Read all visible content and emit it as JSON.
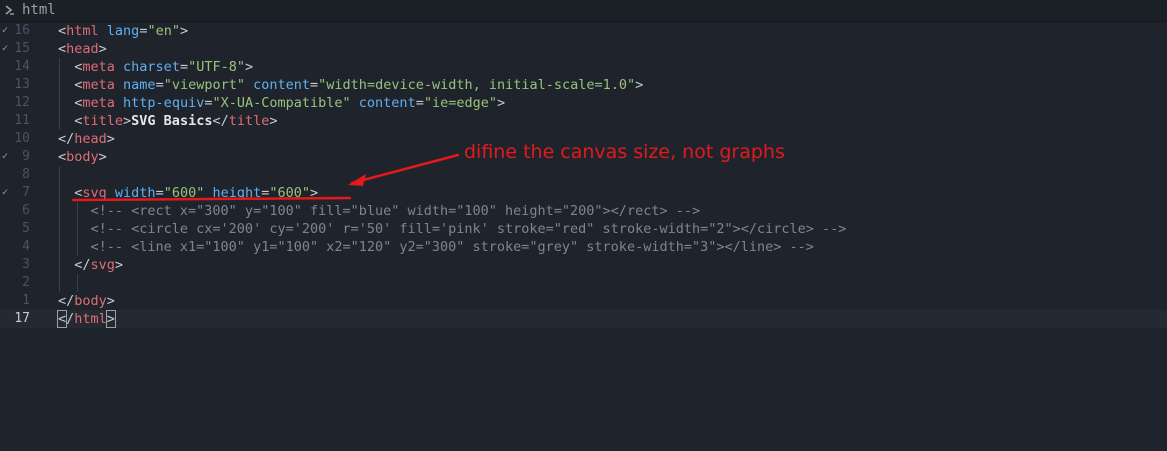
{
  "tab": {
    "label": "html",
    "icon": "file-code-icon"
  },
  "annotation": {
    "text": "difine the canvas size, not graphs",
    "color": "#e3191c"
  },
  "colors": {
    "background": "#1f242c",
    "tag": "#e06c75",
    "attribute": "#61afef",
    "string": "#98c379",
    "comment": "#7f848e",
    "text": "#c8ccd4"
  },
  "lines": [
    {
      "num": "16",
      "fold": "✓",
      "tokens": [
        {
          "t": "<",
          "c": "punct"
        },
        {
          "t": "html",
          "c": "tag"
        },
        {
          "t": " ",
          "c": "punct"
        },
        {
          "t": "lang",
          "c": "attr"
        },
        {
          "t": "=",
          "c": "punct"
        },
        {
          "t": "\"en\"",
          "c": "str"
        },
        {
          "t": ">",
          "c": "punct"
        }
      ]
    },
    {
      "num": "15",
      "fold": "✓",
      "tokens": [
        {
          "t": "<",
          "c": "punct"
        },
        {
          "t": "head",
          "c": "tag"
        },
        {
          "t": ">",
          "c": "punct"
        }
      ]
    },
    {
      "num": "14",
      "fold": "",
      "tokens": [
        {
          "t": "  <",
          "c": "punct"
        },
        {
          "t": "meta",
          "c": "tag"
        },
        {
          "t": " ",
          "c": "punct"
        },
        {
          "t": "charset",
          "c": "attr"
        },
        {
          "t": "=",
          "c": "punct"
        },
        {
          "t": "\"UTF-8\"",
          "c": "str"
        },
        {
          "t": ">",
          "c": "punct"
        }
      ]
    },
    {
      "num": "13",
      "fold": "",
      "tokens": [
        {
          "t": "  <",
          "c": "punct"
        },
        {
          "t": "meta",
          "c": "tag"
        },
        {
          "t": " ",
          "c": "punct"
        },
        {
          "t": "name",
          "c": "attr"
        },
        {
          "t": "=",
          "c": "punct"
        },
        {
          "t": "\"viewport\"",
          "c": "str"
        },
        {
          "t": " ",
          "c": "punct"
        },
        {
          "t": "content",
          "c": "attr"
        },
        {
          "t": "=",
          "c": "punct"
        },
        {
          "t": "\"width=device-width, initial-scale=1.0\"",
          "c": "str"
        },
        {
          "t": ">",
          "c": "punct"
        }
      ]
    },
    {
      "num": "12",
      "fold": "",
      "tokens": [
        {
          "t": "  <",
          "c": "punct"
        },
        {
          "t": "meta",
          "c": "tag"
        },
        {
          "t": " ",
          "c": "punct"
        },
        {
          "t": "http-equiv",
          "c": "attr"
        },
        {
          "t": "=",
          "c": "punct"
        },
        {
          "t": "\"X-UA-Compatible\"",
          "c": "str"
        },
        {
          "t": " ",
          "c": "punct"
        },
        {
          "t": "content",
          "c": "attr"
        },
        {
          "t": "=",
          "c": "punct"
        },
        {
          "t": "\"ie=edge\"",
          "c": "str"
        },
        {
          "t": ">",
          "c": "punct"
        }
      ]
    },
    {
      "num": "11",
      "fold": "",
      "tokens": [
        {
          "t": "  <",
          "c": "punct"
        },
        {
          "t": "title",
          "c": "tag"
        },
        {
          "t": ">",
          "c": "punct"
        },
        {
          "t": "SVG Basics",
          "c": "bold"
        },
        {
          "t": "</",
          "c": "punct"
        },
        {
          "t": "title",
          "c": "tag"
        },
        {
          "t": ">",
          "c": "punct"
        }
      ]
    },
    {
      "num": "10",
      "fold": "",
      "tokens": [
        {
          "t": "</",
          "c": "punct"
        },
        {
          "t": "head",
          "c": "tag"
        },
        {
          "t": ">",
          "c": "punct"
        }
      ]
    },
    {
      "num": "9",
      "fold": "✓",
      "tokens": [
        {
          "t": "<",
          "c": "punct"
        },
        {
          "t": "body",
          "c": "tag"
        },
        {
          "t": ">",
          "c": "punct"
        }
      ]
    },
    {
      "num": "8",
      "fold": "",
      "tokens": []
    },
    {
      "num": "7",
      "fold": "✓",
      "tokens": [
        {
          "t": "  <",
          "c": "punct"
        },
        {
          "t": "svg",
          "c": "tag"
        },
        {
          "t": " ",
          "c": "punct"
        },
        {
          "t": "width",
          "c": "attr"
        },
        {
          "t": "=",
          "c": "punct"
        },
        {
          "t": "\"600\"",
          "c": "str"
        },
        {
          "t": " ",
          "c": "punct"
        },
        {
          "t": "height",
          "c": "attr"
        },
        {
          "t": "=",
          "c": "punct"
        },
        {
          "t": "\"600\"",
          "c": "str"
        },
        {
          "t": ">",
          "c": "punct"
        }
      ]
    },
    {
      "num": "6",
      "fold": "",
      "tokens": [
        {
          "t": "    <!-- <rect x=\"300\" y=\"100\" fill=\"blue\" width=\"100\" height=\"200\"></rect> -->",
          "c": "comment"
        }
      ]
    },
    {
      "num": "5",
      "fold": "",
      "tokens": [
        {
          "t": "    <!-- <circle cx='200' cy='200' r='50' fill='pink' stroke=\"red\" stroke-width=\"2\"></circle> -->",
          "c": "comment"
        }
      ]
    },
    {
      "num": "4",
      "fold": "",
      "tokens": [
        {
          "t": "    <!-- <line x1=\"100\" y1=\"100\" x2=\"120\" y2=\"300\" stroke=\"grey\" stroke-width=\"3\"></line> -->",
          "c": "comment"
        }
      ]
    },
    {
      "num": "3",
      "fold": "",
      "tokens": [
        {
          "t": "  </",
          "c": "punct"
        },
        {
          "t": "svg",
          "c": "tag"
        },
        {
          "t": ">",
          "c": "punct"
        }
      ]
    },
    {
      "num": "2",
      "fold": "",
      "tokens": []
    },
    {
      "num": "1",
      "fold": "",
      "tokens": [
        {
          "t": "</",
          "c": "punct"
        },
        {
          "t": "body",
          "c": "tag"
        },
        {
          "t": ">",
          "c": "punct"
        }
      ]
    },
    {
      "num": "17",
      "fold": "",
      "current": true,
      "tokens": [
        {
          "t": "<",
          "c": "punct",
          "cursor": true
        },
        {
          "t": "/",
          "c": "punct"
        },
        {
          "t": "html",
          "c": "tag"
        },
        {
          "t": ">",
          "c": "punct",
          "cursor": true
        }
      ]
    }
  ]
}
